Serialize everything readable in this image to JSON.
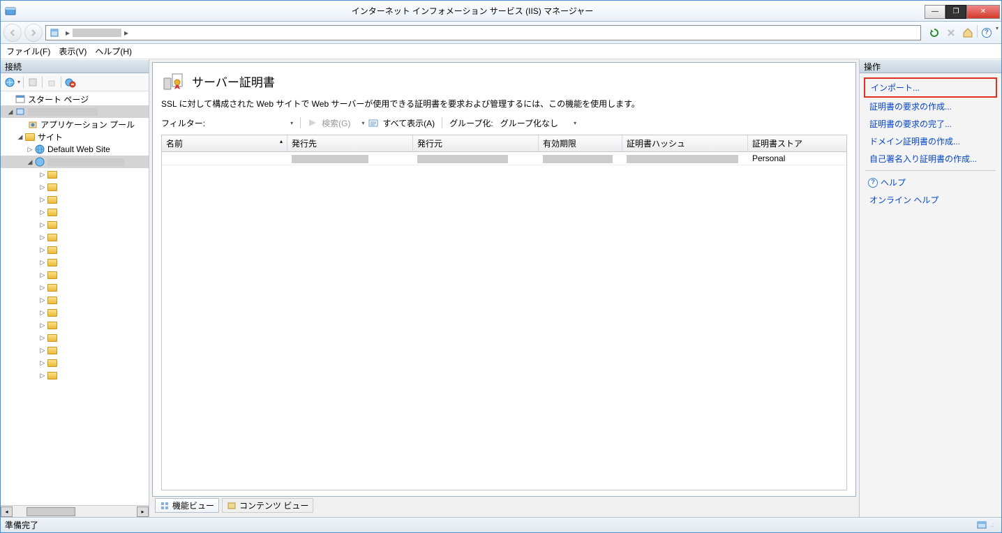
{
  "window": {
    "title": "インターネット インフォメーション サービス (IIS) マネージャー"
  },
  "menubar": {
    "file": "ファイル(F)",
    "view": "表示(V)",
    "help": "ヘルプ(H)"
  },
  "connections": {
    "header": "接続",
    "start_page": "スタート ページ",
    "app_pools": "アプリケーション プール",
    "sites": "サイト",
    "default_site": "Default Web Site"
  },
  "feature": {
    "title": "サーバー証明書",
    "description": "SSL に対して構成された Web サイトで Web サーバーが使用できる証明書を要求および管理するには、この機能を使用します。",
    "filter_label": "フィルター:",
    "search_label": "検索(G)",
    "show_all_label": "すべて表示(A)",
    "group_label": "グループ化:",
    "group_none": "グループ化なし"
  },
  "grid": {
    "columns": {
      "name": "名前",
      "issued_to": "発行先",
      "issued_by": "発行元",
      "expiration": "有効期限",
      "hash": "証明書ハッシュ",
      "store": "証明書ストア"
    },
    "rows": [
      {
        "store": "Personal"
      }
    ]
  },
  "view_tabs": {
    "features": "機能ビュー",
    "content": "コンテンツ ビュー"
  },
  "actions": {
    "header": "操作",
    "import": "インポート...",
    "create_req": "証明書の要求の作成...",
    "complete_req": "証明書の要求の完了...",
    "create_domain": "ドメイン証明書の作成...",
    "create_self": "自己署名入り証明書の作成...",
    "help": "ヘルプ",
    "online_help": "オンライン ヘルプ"
  },
  "statusbar": {
    "ready": "準備完了"
  }
}
